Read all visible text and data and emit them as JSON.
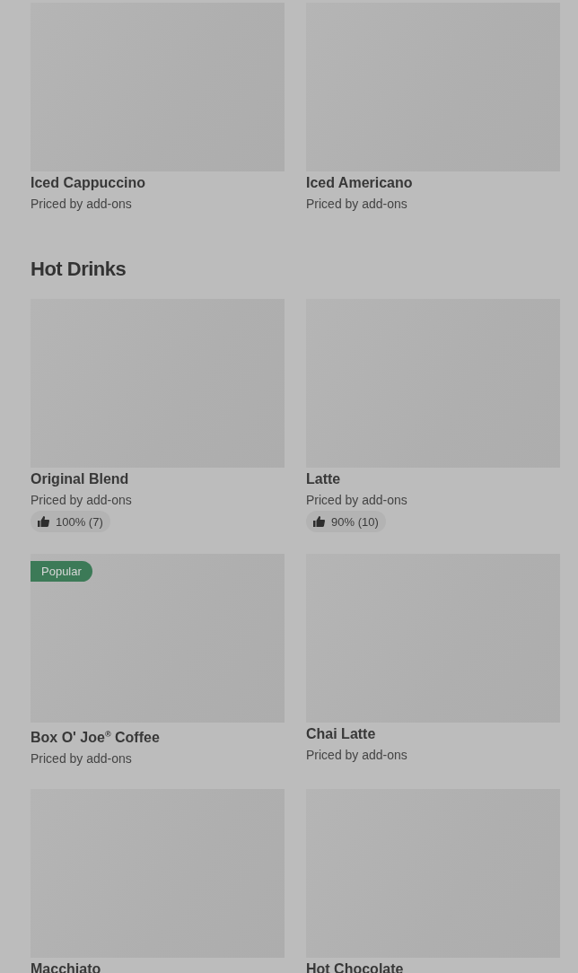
{
  "sections": [
    {
      "items": [
        {
          "name": "Iced Cappuccino",
          "subtitle": "Priced by add-ons"
        },
        {
          "name": "Iced Americano",
          "subtitle": "Priced by add-ons"
        }
      ]
    },
    {
      "title": "Hot Drinks",
      "items": [
        {
          "name": "Original Blend",
          "subtitle": "Priced by add-ons",
          "rating": "100% (7)"
        },
        {
          "name": "Latte",
          "subtitle": "Priced by add-ons",
          "rating": "90% (10)"
        },
        {
          "name": "Box O' Joe$^{®}$ Coffee",
          "subtitle": "Priced by add-ons",
          "badge": "Popular"
        },
        {
          "name": "Chai Latte",
          "subtitle": "Priced by add-ons"
        },
        {
          "name": "Macchiato"
        },
        {
          "name": "Hot Chocolate"
        }
      ]
    }
  ]
}
